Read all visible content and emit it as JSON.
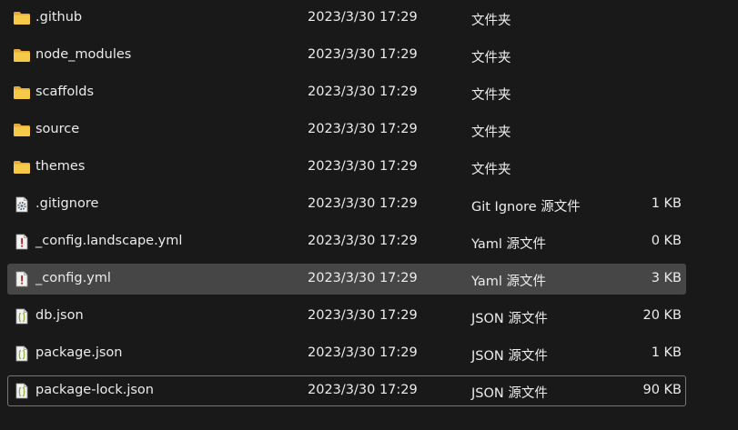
{
  "files": [
    {
      "name": ".github",
      "date": "2023/3/30 17:29",
      "type": "文件夹",
      "size": "",
      "icon": "folder-icon"
    },
    {
      "name": "node_modules",
      "date": "2023/3/30 17:29",
      "type": "文件夹",
      "size": "",
      "icon": "folder-icon"
    },
    {
      "name": "scaffolds",
      "date": "2023/3/30 17:29",
      "type": "文件夹",
      "size": "",
      "icon": "folder-icon"
    },
    {
      "name": "source",
      "date": "2023/3/30 17:29",
      "type": "文件夹",
      "size": "",
      "icon": "folder-icon"
    },
    {
      "name": "themes",
      "date": "2023/3/30 17:29",
      "type": "文件夹",
      "size": "",
      "icon": "folder-icon"
    },
    {
      "name": ".gitignore",
      "date": "2023/3/30 17:29",
      "type": "Git Ignore 源文件",
      "size": "1 KB",
      "icon": "gear-file-icon"
    },
    {
      "name": "_config.landscape.yml",
      "date": "2023/3/30 17:29",
      "type": "Yaml 源文件",
      "size": "0 KB",
      "icon": "yaml-file-icon"
    },
    {
      "name": "_config.yml",
      "date": "2023/3/30 17:29",
      "type": "Yaml 源文件",
      "size": "3 KB",
      "icon": "yaml-file-icon",
      "selected": true
    },
    {
      "name": "db.json",
      "date": "2023/3/30 17:29",
      "type": "JSON 源文件",
      "size": "20 KB",
      "icon": "json-file-icon"
    },
    {
      "name": "package.json",
      "date": "2023/3/30 17:29",
      "type": "JSON 源文件",
      "size": "1 KB",
      "icon": "json-file-icon"
    },
    {
      "name": "package-lock.json",
      "date": "2023/3/30 17:29",
      "type": "JSON 源文件",
      "size": "90 KB",
      "icon": "json-file-icon",
      "focused": true
    }
  ],
  "colors": {
    "background": "#191919",
    "text": "#ececec",
    "selected_row": "#464646",
    "focus_border": "#777777",
    "folder": "#f4c24a",
    "json_brace": "#9bbf3c"
  }
}
